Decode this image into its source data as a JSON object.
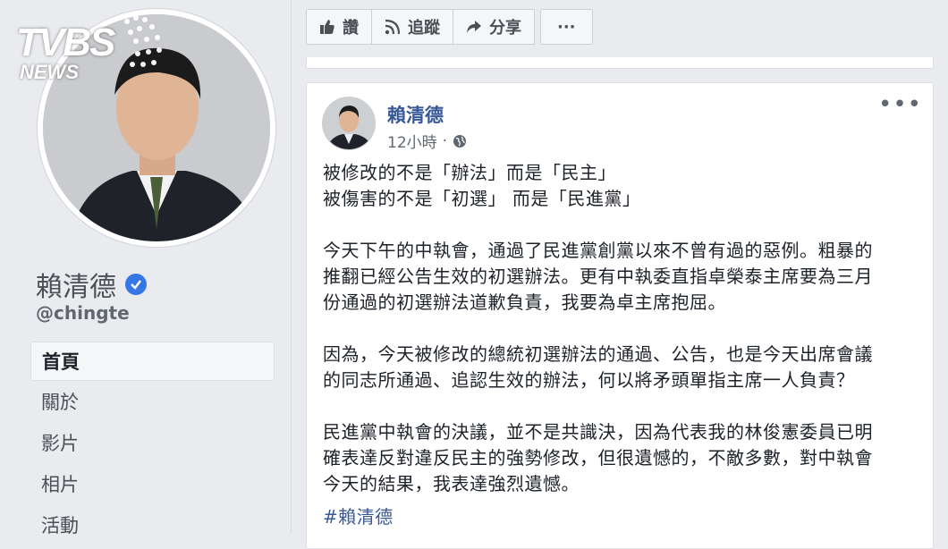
{
  "watermark": {
    "brand": "TVBS",
    "sub": "NEWS"
  },
  "profile": {
    "name": "賴清德",
    "handle": "@chingte",
    "nav": [
      "首頁",
      "關於",
      "影片",
      "相片",
      "活動"
    ]
  },
  "page_actions": {
    "like": "讚",
    "follow": "追蹤",
    "share": "分享",
    "more": "···"
  },
  "post": {
    "author": "賴清德",
    "time": "12小時",
    "paragraphs": [
      [
        "被修改的不是「辦法」而是「民主」",
        "被傷害的不是「初選」 而是「民進黨」"
      ],
      [
        "今天下午的中執會，通過了民進黨創黨以來不曾有過的惡例。粗暴的",
        "推翻已經公告生效的初選辦法。更有中執委直指卓榮泰主席要為三月",
        "份通過的初選辦法道歉負責，我要為卓主席抱屈。"
      ],
      [
        "因為，今天被修改的總統初選辦法的通過、公告，也是今天出席會議",
        "的同志所通過、追認生效的辦法，何以將矛頭單指主席一人負責？"
      ],
      [
        "民進黨中執會的決議，並不是共識決，因為代表我的林俊憲委員已明",
        "確表達反對違反民主的強勢修改，但很遺憾的，不敵多數，對中執會",
        "今天的結果，我表達強烈遺憾。"
      ]
    ],
    "hashtag": "#賴清德"
  }
}
